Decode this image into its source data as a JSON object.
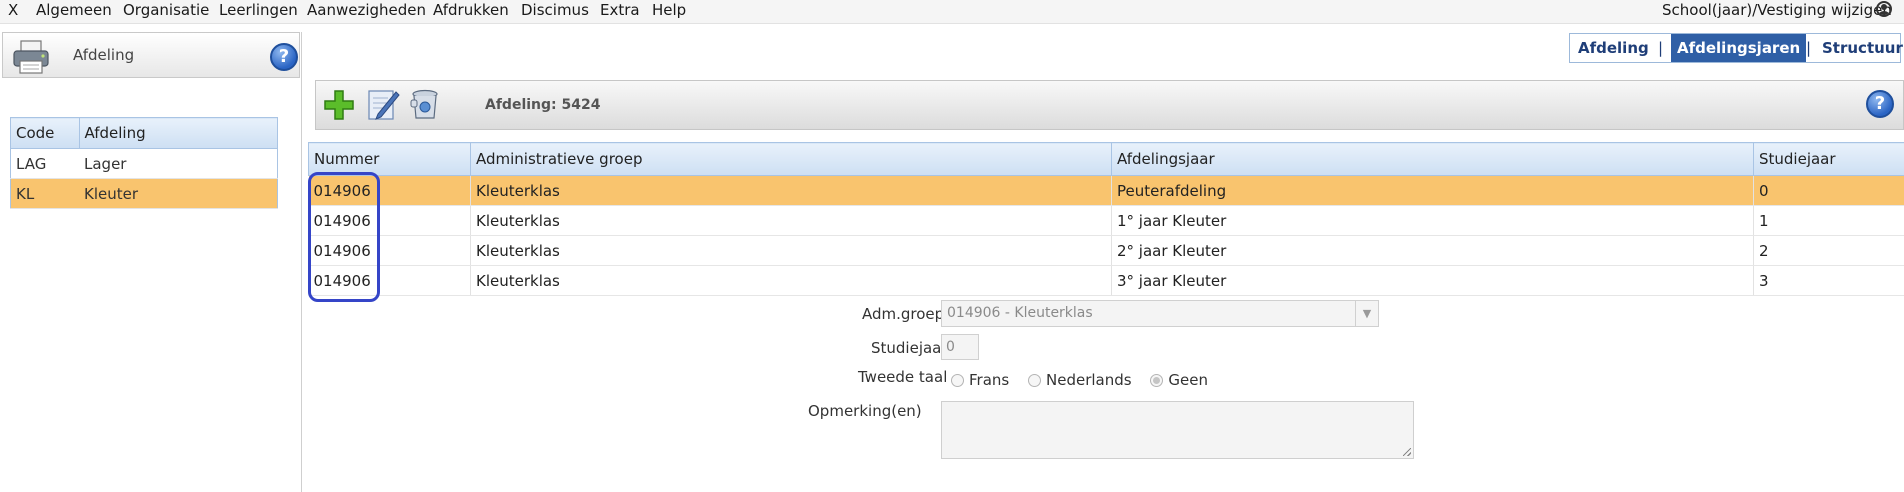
{
  "menubar": {
    "close": "X",
    "items": [
      "Algemeen",
      "Organisatie",
      "Leerlingen",
      "Aanwezigheden",
      "Afdrukken",
      "Discimus",
      "Extra",
      "Help"
    ],
    "school_link": "School(jaar)/Vestiging wijzigen"
  },
  "left_panel": {
    "title": "Afdeling",
    "help": "?",
    "columns": [
      "Code",
      "Afdeling"
    ],
    "rows": [
      {
        "code": "LAG",
        "afdeling": "Lager"
      },
      {
        "code": "KL",
        "afdeling": "Kleuter"
      }
    ],
    "selected_index": 1
  },
  "tabs": {
    "items": [
      "Afdeling",
      "Afdelingsjaren",
      "Structuur"
    ],
    "separator": "|",
    "active": "Afdelingsjaren"
  },
  "toolbar": {
    "label": "Afdeling: 5424",
    "help": "?",
    "buttons": [
      "add-icon",
      "edit-icon",
      "delete-icon"
    ]
  },
  "grid": {
    "columns": [
      "Nummer",
      "Administratieve groep",
      "Afdelingsjaar",
      "Studiejaar"
    ],
    "rows": [
      {
        "nummer": "014906",
        "groep": "Kleuterklas",
        "jaar": "Peuterafdeling",
        "studiejaar": "0"
      },
      {
        "nummer": "014906",
        "groep": "Kleuterklas",
        "jaar": "1° jaar Kleuter",
        "studiejaar": "1"
      },
      {
        "nummer": "014906",
        "groep": "Kleuterklas",
        "jaar": "2° jaar Kleuter",
        "studiejaar": "2"
      },
      {
        "nummer": "014906",
        "groep": "Kleuterklas",
        "jaar": "3° jaar Kleuter",
        "studiejaar": "3"
      }
    ],
    "selected_index": 0
  },
  "form": {
    "adm_groep_label": "Adm.groep",
    "adm_groep_value": "014906 - Kleuterklas",
    "studiejaar_label": "Studiejaar",
    "studiejaar_value": "0",
    "tweede_taal_label": "Tweede taal",
    "tweede_taal_options": [
      "Frans",
      "Nederlands",
      "Geen"
    ],
    "tweede_taal_selected": "Geen",
    "opmerking_label": "Opmerking(en)",
    "opmerking_value": ""
  },
  "colors": {
    "selected_row": "#f9c46e",
    "header_blue": "#cddff3",
    "active_tab": "#2f5fa6",
    "annotation_box": "#3545c8"
  }
}
